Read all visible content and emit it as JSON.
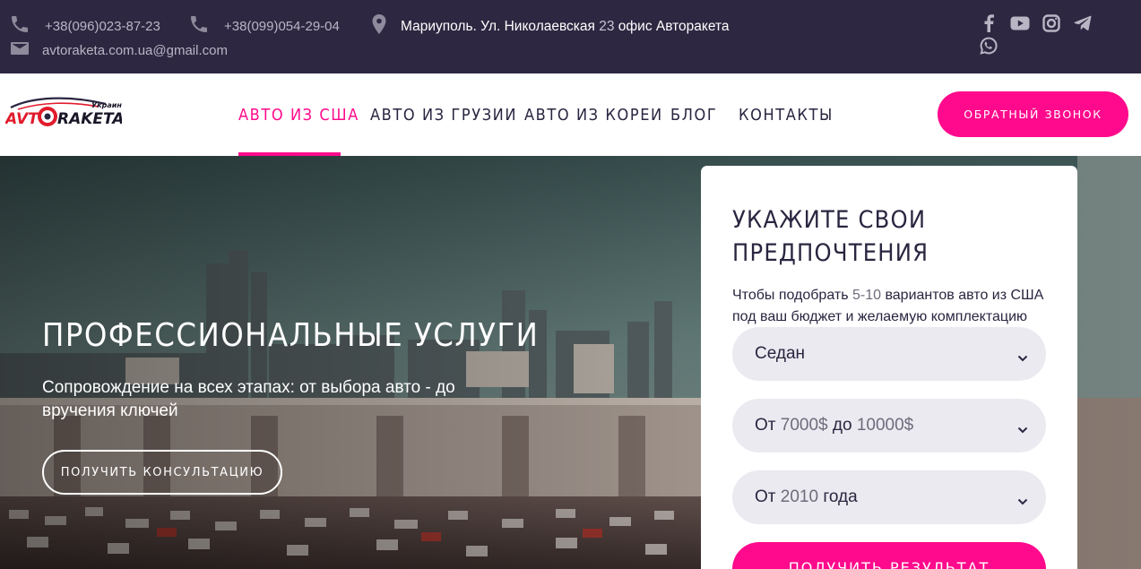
{
  "topbar": {
    "phone1": "+38(096)023-87-23",
    "phone2": "+38(099)054-29-04",
    "address": {
      "prefix": "Мариуполь. Ул. Николаевская ",
      "number": "23",
      "suffix": " офис Авторакета"
    },
    "email": "avtoraketa.com.ua@gmail.com",
    "socials": [
      "facebook-icon",
      "youtube-icon",
      "instagram-icon",
      "telegram-icon",
      "whatsapp-icon"
    ]
  },
  "brand": {
    "logo_main": "AVTORAKETA",
    "logo_sub": "Украина"
  },
  "nav": {
    "items": [
      "АВТО ИЗ США",
      "АВТО ИЗ ГРУЗИИ",
      "АВТО ИЗ КОРЕИ",
      "БЛОГ",
      "КОНТАКТЫ"
    ],
    "active_index": 0,
    "callback_label": "ОБРАТНЫЙ ЗВОНОК"
  },
  "hero": {
    "title": "ПРОФЕССИОНАЛЬНЫЕ УСЛУГИ",
    "subtitle": "Сопровождение на всех этапах: от выбора авто - до вручения ключей",
    "cta_label": "ПОЛУЧИТЬ КОНСУЛЬТАЦИЮ"
  },
  "form": {
    "title": "УКАЖИТЕ СВОИ ПРЕДПОЧТЕНИЯ",
    "description": {
      "prefix": "Чтобы подобрать ",
      "range": "5-10",
      "suffix": " вариантов авто из США под ваш бюджет и желаемую комплектацию"
    },
    "body_type": "Седан",
    "price": {
      "from_label": "От ",
      "from_value": "7000$",
      "to_label": " до ",
      "to_value": "10000$"
    },
    "year": {
      "from_label": "От ",
      "value": "2010",
      "suffix": " года"
    },
    "submit_label": "ПОЛУЧИТЬ РЕЗУЛЬТАТ"
  },
  "colors": {
    "accent": "#ff0a8c",
    "topbar": "#2e2741",
    "text": "#2a2540",
    "select_bg": "#ebeaf0"
  }
}
